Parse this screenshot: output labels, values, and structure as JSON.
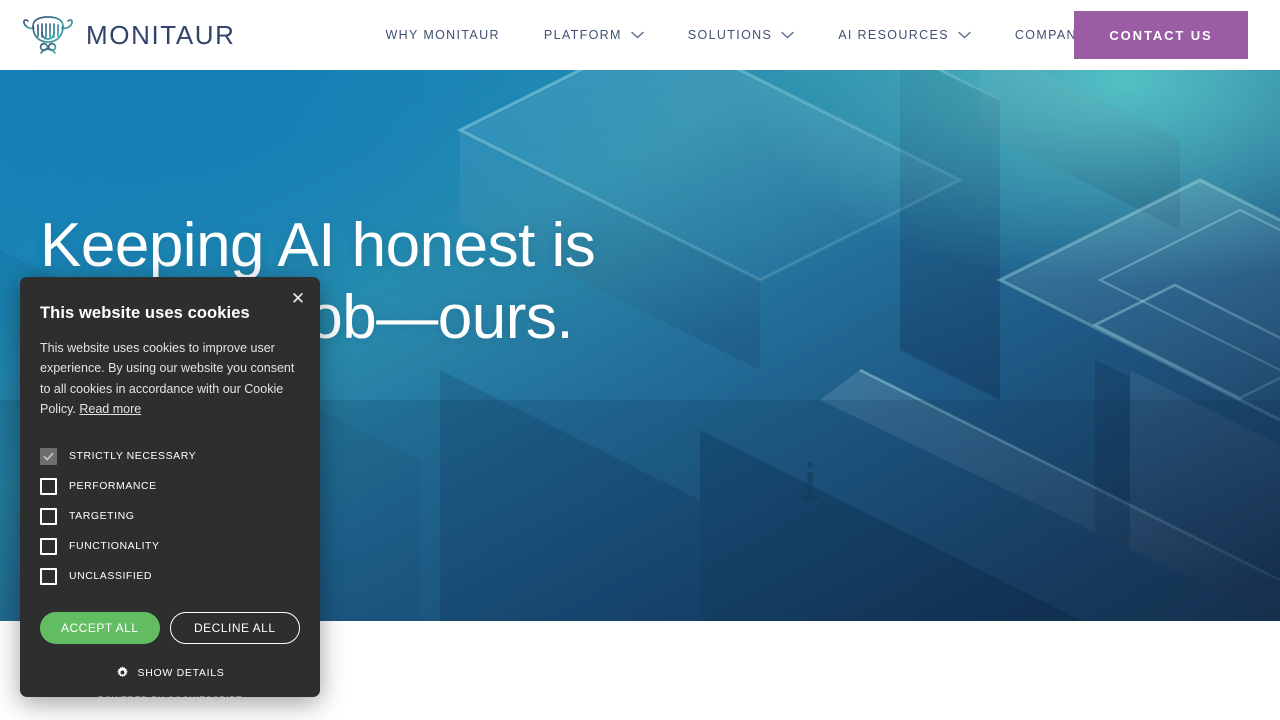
{
  "header": {
    "brand_name": "MONITAUR",
    "logo_icon": "minotaur-bull-head-icon",
    "nav": [
      {
        "label": "WHY MONITAUR",
        "has_dropdown": false
      },
      {
        "label": "PLATFORM",
        "has_dropdown": true
      },
      {
        "label": "SOLUTIONS",
        "has_dropdown": true
      },
      {
        "label": "AI RESOURCES",
        "has_dropdown": true
      },
      {
        "label": "COMPANY",
        "has_dropdown": true
      }
    ],
    "cta_label": "CONTACT US",
    "cta_color": "#9a5ca3",
    "brand_text_color": "#31456b",
    "nav_text_color": "#3f5172"
  },
  "hero": {
    "title_line1": "Keeping AI honest is",
    "title_line2": "job—ours.",
    "background_art": "isometric-maze-illustration",
    "gradient_from": "#1683b8",
    "gradient_to": "#17314f",
    "accent_teal": "#56c4c6"
  },
  "cookie": {
    "close_icon": "close-icon",
    "heading": "This website uses cookies",
    "body": "This website uses cookies to improve user experience. By using our website you consent to all cookies in accordance with our Cookie Policy.",
    "read_more": "Read more",
    "options": [
      {
        "label": "STRICTLY NECESSARY",
        "checked": true,
        "locked": true
      },
      {
        "label": "PERFORMANCE",
        "checked": false,
        "locked": false
      },
      {
        "label": "TARGETING",
        "checked": false,
        "locked": false
      },
      {
        "label": "FUNCTIONALITY",
        "checked": false,
        "locked": false
      },
      {
        "label": "UNCLASSIFIED",
        "checked": false,
        "locked": false
      }
    ],
    "accept_label": "ACCEPT ALL",
    "decline_label": "DECLINE ALL",
    "details_label": "SHOW DETAILS",
    "details_icon": "gear-icon",
    "powered_by": "POWERED BY COOKIESCRIPT",
    "accept_color": "#63bd62",
    "panel_color": "#2e2e2e"
  }
}
